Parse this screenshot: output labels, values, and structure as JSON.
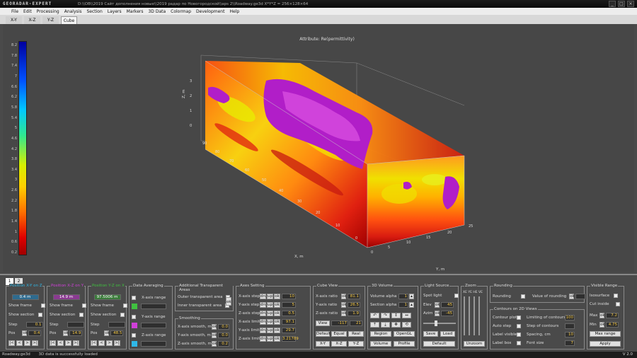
{
  "window": {
    "logo": "GEORADAR-EXPERT",
    "path": "D:\\\\ОВ\\\\2019 Сайт дополнения новые\\\\2019 радар по Новогородской\\\\aps 2\\\\Roadway.ge3d  X*Y*Z = 256×128×64"
  },
  "menu": [
    "File",
    "Edit",
    "Processing",
    "Analysis",
    "Section",
    "Layers",
    "Markers",
    "3D Data",
    "Colormap",
    "Development",
    "Help"
  ],
  "view_tabs": [
    "X-Y",
    "X-Z",
    "Y-Z",
    "Cube"
  ],
  "active_view_tab": "Cube",
  "plot": {
    "title": "Attribute: Re(permittivity)",
    "zlabel": "Z, m",
    "xlabel": "X, m",
    "ylabel": "Y, m",
    "colorbar_ticks": [
      "8.2",
      "7.8",
      "7.4",
      "7",
      "6.6",
      "6.2",
      "5.8",
      "5.4",
      "5",
      "4.6",
      "4.2",
      "3.8",
      "3.4",
      "3",
      "2.6",
      "2.2",
      "1.8",
      "1.4",
      "1",
      "0.6",
      "0.2"
    ],
    "z_ticks": [
      "3",
      "2",
      "1",
      "0"
    ],
    "x_ticks": [
      "90",
      "80",
      "70",
      "60",
      "50",
      "40",
      "30",
      "20",
      "10",
      "0"
    ],
    "y_ticks": [
      "25",
      "20",
      "15",
      "10",
      "5",
      "0"
    ],
    "colors": {
      "background": "#474747",
      "cube_red": "#d81c10",
      "cube_orange": "#ff7a10",
      "cube_yellow": "#f0e000",
      "cube_magenta": "#b11ec8"
    }
  },
  "panel_tabs": [
    "1",
    "2"
  ],
  "position_xy": {
    "title": "Position X-Y on Z",
    "value": "0.4 m",
    "show_frame": "Show frame",
    "show_section": "Show section",
    "step_label": "Step",
    "step": "0.1",
    "pos_label": "Pos",
    "pos": "0.4",
    "title_color": "#2fb8e8"
  },
  "position_xz": {
    "title": "Position X-Z on Y",
    "value": "14.9 m",
    "show_frame": "Show frame",
    "show_section": "Show section",
    "step_label": "Step",
    "step": "",
    "pos_label": "Pos",
    "pos": "14.9",
    "title_color": "#d040d8"
  },
  "position_yz": {
    "title": "Position Y-Z on X",
    "value": "97.5006 m",
    "show_frame": "Show frame",
    "show_section": "Show section",
    "step_label": "Step",
    "step": "",
    "pos_label": "Pos",
    "pos": "48.5",
    "title_color": "#40c040"
  },
  "data_averaging": {
    "title": "Data Averaging",
    "x": "X-axis range",
    "y": "Y-axis range",
    "z": "Z-axis range"
  },
  "transparent": {
    "title": "Additional Transparent Areas",
    "outer": "Outer transparent area",
    "inner": "Inner transparent area"
  },
  "smoothing": {
    "title": "Smoothing",
    "x": "X-axis smooth, m",
    "y": "Y-axis smooth, m",
    "z": "Z-axis smooth, m",
    "xv": "0.0",
    "yv": "0.0",
    "zv": "0.2"
  },
  "axes": {
    "title": "Axes Setting",
    "rows": [
      {
        "l": "X-axis step",
        "v": "10"
      },
      {
        "l": "Y-axis step",
        "v": "5"
      },
      {
        "l": "Z-axis step",
        "v": "0.5"
      },
      {
        "l": "X-axis limit",
        "v": "97.1"
      },
      {
        "l": "Y-axis limit",
        "v": "29.7"
      },
      {
        "l": "Z-axis limit",
        "v": "3.21789"
      }
    ]
  },
  "cube_view": {
    "title": "Cube View",
    "rows": [
      {
        "l": "X-axis ratio",
        "v": "81.1"
      },
      {
        "l": "Y-axis ratio",
        "v": "26.5"
      },
      {
        "l": "Z-axis ratio",
        "v": "1.9"
      }
    ],
    "view": "View",
    "view_a": "-117",
    "view_b": "21",
    "default": "Default",
    "equal": "Equal",
    "real": "Real",
    "xy": "X-Y",
    "xz": "X-Z",
    "yz": "Y-Z"
  },
  "volume": {
    "title": "3D Volume",
    "alpha": "Volume alpha",
    "alpha_v": "1",
    "section": "Section alpha",
    "section_v": "1",
    "region": "Region",
    "opengl": "OpenGL",
    "volume": "Volume",
    "profile": "Profile"
  },
  "light": {
    "title": "Light Source",
    "spot": "Spot light",
    "elev": "Elev",
    "elev_v": "45",
    "azim": "Azim",
    "azim_v": "-45",
    "save": "Save",
    "load": "Load",
    "default": "Default"
  },
  "zoom": {
    "title": "Zoom",
    "labels": "XE YE HE VE",
    "unzoom": "Unzoom"
  },
  "rounding": {
    "title": "Rounding",
    "rounding": "Rounding",
    "value": "Value of rounding"
  },
  "contours": {
    "title": "Contours on 2D Views",
    "plot": "Contour plot",
    "auto": "Auto step",
    "visible": "Label visible",
    "box": "Label box",
    "limiting": "Limiting of contours",
    "limiting_v": "100",
    "step": "Step of contours",
    "step_v": "",
    "spacing": "Spacing, cm",
    "spacing_v": "10",
    "font": "Font size",
    "font_v": "7"
  },
  "visible_range": {
    "title": "Visible Range",
    "iso": "Isosurface",
    "cut": "Cut inside",
    "max": "Max",
    "max_v": "7.2",
    "min": "Min",
    "min_v": "4.75",
    "max_range": "Max range",
    "apply": "Apply"
  },
  "status": {
    "file": "Roadway.ge3d",
    "msg": "3D data is successfully loaded",
    "version": "V 2.0"
  }
}
